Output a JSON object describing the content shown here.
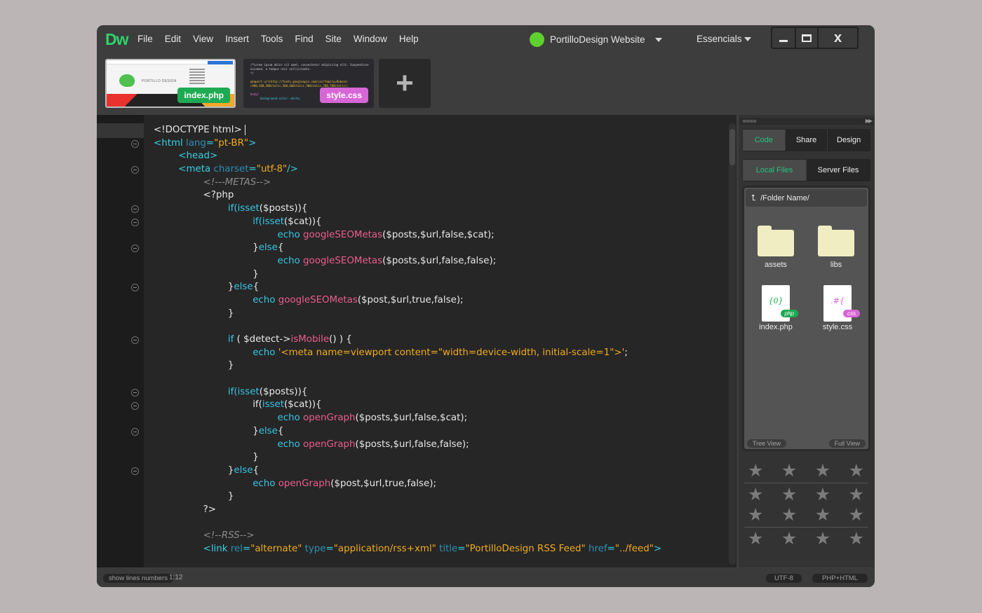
{
  "app": {
    "logo": "Dw"
  },
  "menu": [
    "File",
    "Edit",
    "View",
    "Insert",
    "Tools",
    "Find",
    "Site",
    "Window",
    "Help"
  ],
  "site": {
    "name": "PortilloDesign Website"
  },
  "workspace": {
    "label": "Essencials"
  },
  "window_controls": {
    "close_glyph": "x"
  },
  "tabs": [
    {
      "label": "index.php",
      "thumb_brand": "PORTILLO DESIGN"
    },
    {
      "label": "style.css",
      "thumb_lines": [
        "/*Lorem ipsum dolor sit amet, consectetur adipiscing elit. Suspendisse",
        "euismod, a tempus nisi sollicitudin.",
        "*/",
        "@import url(http://fonts.googleapis.com/css?family=Roboto:",
        "r400,300,500italic,500,400italic,500italic,700,700italic);",
        "body{",
        "background-color: white;"
      ]
    }
  ],
  "add_tab": {
    "glyph": "+"
  },
  "editor": {
    "code_lines": [
      [
        {
          "t": "<!DOCTYPE html>",
          "c": ""
        }
      ],
      [
        {
          "t": "<html ",
          "c": "tag"
        },
        {
          "t": "lang",
          "c": "attr"
        },
        {
          "t": "=",
          "c": "tag"
        },
        {
          "t": "\"pt-BR\"",
          "c": "str"
        },
        {
          "t": ">",
          "c": "tag"
        }
      ],
      [
        {
          "t": "<head>",
          "c": "tag"
        }
      ],
      [
        {
          "t": "<meta ",
          "c": "tag"
        },
        {
          "t": "charset",
          "c": "attr"
        },
        {
          "t": "=",
          "c": "tag"
        },
        {
          "t": "\"utf-8\"",
          "c": "str"
        },
        {
          "t": "/>",
          "c": "tag"
        }
      ],
      [
        {
          "t": "<!---METAS-->",
          "c": "cmt"
        }
      ],
      [
        {
          "t": "<?php",
          "c": ""
        }
      ],
      [
        {
          "t": "if(",
          "c": "kw"
        },
        {
          "t": "isset",
          "c": "kw"
        },
        {
          "t": "($posts)){",
          "c": ""
        }
      ],
      [
        {
          "t": "if(",
          "c": "kw"
        },
        {
          "t": "isset",
          "c": "kw"
        },
        {
          "t": "($cat)){",
          "c": ""
        }
      ],
      [
        {
          "t": "echo ",
          "c": "kw"
        },
        {
          "t": "googleSEOMetas",
          "c": "fn"
        },
        {
          "t": "($posts,$url,false,$cat);",
          "c": ""
        }
      ],
      [
        {
          "t": "}",
          "c": ""
        },
        {
          "t": "else",
          "c": "kw"
        },
        {
          "t": "{",
          "c": ""
        }
      ],
      [
        {
          "t": "echo ",
          "c": "kw"
        },
        {
          "t": "googleSEOMetas",
          "c": "fn"
        },
        {
          "t": "($posts,$url,false,false);",
          "c": ""
        }
      ],
      [
        {
          "t": "}",
          "c": ""
        }
      ],
      [
        {
          "t": "}",
          "c": ""
        },
        {
          "t": "else",
          "c": "kw"
        },
        {
          "t": "{",
          "c": ""
        }
      ],
      [
        {
          "t": "echo ",
          "c": "kw"
        },
        {
          "t": "googleSEOMetas",
          "c": "fn"
        },
        {
          "t": "($post,$url,true,false);",
          "c": ""
        }
      ],
      [
        {
          "t": "}",
          "c": ""
        }
      ],
      [],
      [
        {
          "t": "if ",
          "c": "kw"
        },
        {
          "t": "( $detect->",
          "c": ""
        },
        {
          "t": "isMobile",
          "c": "fn"
        },
        {
          "t": "() ) {",
          "c": ""
        }
      ],
      [
        {
          "t": "echo ",
          "c": "kw"
        },
        {
          "t": "'<meta name=viewport content=\"width=device-width, initial-scale=1\">'",
          "c": "str"
        },
        {
          "t": ";",
          "c": ""
        }
      ],
      [
        {
          "t": "}",
          "c": ""
        }
      ],
      [],
      [
        {
          "t": "if(",
          "c": "kw"
        },
        {
          "t": "isset",
          "c": "kw"
        },
        {
          "t": "($posts)){",
          "c": ""
        }
      ],
      [
        {
          "t": "if(",
          "c": ""
        },
        {
          "t": "isset",
          "c": "kw"
        },
        {
          "t": "($cat)){",
          "c": ""
        }
      ],
      [
        {
          "t": "echo ",
          "c": "kw"
        },
        {
          "t": "openGraph",
          "c": "fn"
        },
        {
          "t": "($posts,$url,false,$cat);",
          "c": ""
        }
      ],
      [
        {
          "t": "}",
          "c": ""
        },
        {
          "t": "else",
          "c": "kw"
        },
        {
          "t": "{",
          "c": ""
        }
      ],
      [
        {
          "t": "echo ",
          "c": "kw"
        },
        {
          "t": "openGraph",
          "c": "fn"
        },
        {
          "t": "($posts,$url,false,false);",
          "c": ""
        }
      ],
      [
        {
          "t": "}",
          "c": ""
        }
      ],
      [
        {
          "t": "}",
          "c": ""
        },
        {
          "t": "else",
          "c": "kw"
        },
        {
          "t": "{",
          "c": ""
        }
      ],
      [
        {
          "t": "echo ",
          "c": "kw"
        },
        {
          "t": "openGraph",
          "c": "fn"
        },
        {
          "t": "($post,$url,true,false);",
          "c": ""
        }
      ],
      [
        {
          "t": "}",
          "c": ""
        }
      ],
      [
        {
          "t": "?>",
          "c": ""
        }
      ],
      [],
      [
        {
          "t": "<!--RSS-->",
          "c": "cmt"
        }
      ],
      [
        {
          "t": "<link ",
          "c": "tag"
        },
        {
          "t": "rel",
          "c": "attr"
        },
        {
          "t": "=",
          "c": "tag"
        },
        {
          "t": "\"alternate\"",
          "c": "str"
        },
        {
          "t": " type",
          "c": "attr"
        },
        {
          "t": "=",
          "c": "tag"
        },
        {
          "t": "\"application/rss+xml\"",
          "c": "str"
        },
        {
          "t": " title",
          "c": "attr"
        },
        {
          "t": "=",
          "c": "tag"
        },
        {
          "t": "\"PortilloDesign RSS Feed\"",
          "c": "str"
        },
        {
          "t": " href",
          "c": "attr"
        },
        {
          "t": "=",
          "c": "tag"
        },
        {
          "t": "\"../feed\"",
          "c": "str"
        },
        {
          "t": ">",
          "c": "tag"
        }
      ]
    ],
    "indent_levels": [
      0,
      0,
      1,
      1,
      2,
      2,
      3,
      4,
      5,
      4,
      5,
      4,
      3,
      4,
      3,
      0,
      3,
      4,
      3,
      0,
      3,
      4,
      5,
      4,
      5,
      4,
      3,
      4,
      3,
      2,
      0,
      2,
      2
    ]
  },
  "panel": {
    "view_tabs": [
      "Code",
      "Share",
      "Design"
    ],
    "file_tabs": [
      "Local Files",
      "Server Files"
    ],
    "path": "/Folder Name/",
    "items": [
      {
        "name": "assets",
        "kind": "folder"
      },
      {
        "name": "libs",
        "kind": "folder"
      },
      {
        "name": "index.php",
        "kind": "file",
        "badge": "php",
        "glyph": "{0}"
      },
      {
        "name": "style.css",
        "kind": "file",
        "badge": "css",
        "glyph": ".#{"
      }
    ],
    "tree_view": "Tree View",
    "full_view": "Full View",
    "star_glyph": "★"
  },
  "status": {
    "toggle": "show lines numbers",
    "position": "1:12",
    "encoding": "UTF-8",
    "doctype": "PHP+HTML"
  },
  "colors": {
    "logo": "#2fd26a",
    "site_dot": "#5ed12e",
    "php_badge": "#1eaa52",
    "css_badge": "#d766d6",
    "tag": "#36d0e6",
    "attribute": "#2c8fb6",
    "string": "#f2ab1f",
    "function": "#ec5d8d",
    "active_tab_text": "#25c47f"
  }
}
